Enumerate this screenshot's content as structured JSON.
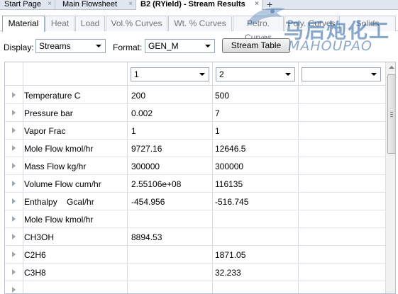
{
  "doc_tabs": [
    {
      "label": "Start Page",
      "active": false
    },
    {
      "label": "Main Flowsheet",
      "active": false
    },
    {
      "label": "B2 (RYield) - Stream Results",
      "active": true
    }
  ],
  "new_tab_symbol": "+",
  "close_symbol": "×",
  "watermark": {
    "chinese": "马后炮化工",
    "english": "MAHOUPAO"
  },
  "sub_tabs": [
    "Material",
    "Heat",
    "Load",
    "Vol.% Curves",
    "Wt. % Curves",
    "Petro. Curves",
    "Poly. Curves",
    "Solids"
  ],
  "active_sub_tab": "Material",
  "toolbar": {
    "display_label": "Display:",
    "display_value": "Streams",
    "format_label": "Format:",
    "format_value": "GEN_M",
    "stream_table_button": "Stream Table"
  },
  "grid": {
    "stream_columns": [
      "1",
      "2",
      ""
    ],
    "rows": [
      {
        "label": "Temperature C",
        "values": [
          "200",
          "500"
        ]
      },
      {
        "label": "Pressure bar",
        "values": [
          "0.002",
          "7"
        ]
      },
      {
        "label": "Vapor Frac",
        "values": [
          "1",
          "1"
        ]
      },
      {
        "label": "Mole Flow kmol/hr",
        "values": [
          "9727.16",
          "12646.5"
        ]
      },
      {
        "label": "Mass Flow kg/hr",
        "values": [
          "300000",
          "300000"
        ]
      },
      {
        "label": "Volume Flow cum/hr",
        "values": [
          "2.55106e+08",
          "116135"
        ]
      },
      {
        "label": "Enthalpy    Gcal/hr",
        "values": [
          "-454.956",
          "-516.745"
        ]
      },
      {
        "label": "Mole Flow kmol/hr",
        "values": [
          "",
          ""
        ]
      },
      {
        "label": "CH3OH",
        "values": [
          "8894.53",
          ""
        ]
      },
      {
        "label": "C2H6",
        "values": [
          "",
          "1871.05"
        ]
      },
      {
        "label": "C3H8",
        "values": [
          "",
          "32.233"
        ]
      },
      {
        "label": "",
        "values": [
          "",
          ""
        ]
      }
    ]
  },
  "colors": {
    "tab_strip": "#dfe6ef",
    "grid_line": "#d6dbe2",
    "inactive_tab_text": "#6d7580",
    "watermark": "#2860a0"
  }
}
